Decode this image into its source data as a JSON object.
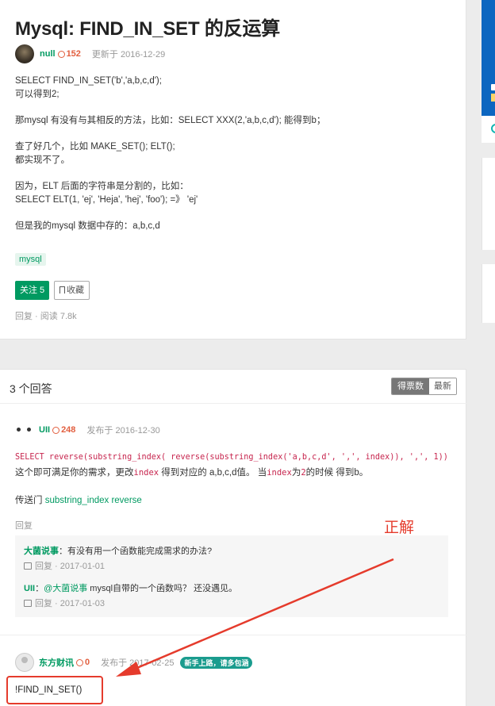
{
  "question": {
    "title": "Mysql: FIND_IN_SET 的反运算",
    "author": "null",
    "reputation": "152",
    "updated": "更新于 2016-12-29",
    "body": [
      "SELECT FIND_IN_SET('b','a,b,c,d');\n可以得到2;",
      "那mysql 有没有与其相反的方法，比如：SELECT XXX(2,'a,b,c,d'); 能得到b；",
      "查了好几个，比如 MAKE_SET(); ELT();\n都实现不了。",
      "因为，ELT 后面的字符串是分割的，比如：\nSELECT ELT(1, 'ej', 'Heja', 'hej', 'foo'); =》 'ej'",
      "但是我的mysql 数据中存的：a,b,c,d"
    ],
    "tag": "mysql",
    "follow_label": "关注 5",
    "favorite_label": "收藏",
    "actions": "回复 · 阅读 7.8k"
  },
  "answers_header": {
    "count_label": "3 个回答",
    "sort_votes": "得票数",
    "sort_latest": "最新"
  },
  "answer1": {
    "author": "UII",
    "reputation": "248",
    "date": "发布于 2016-12-30",
    "code": "SELECT reverse(substring_index( reverse(substring_index('a,b,c,d', ',', index)), ',', 1))",
    "text_a": "这个即可满足你的需求，更改",
    "kw1": "index",
    "text_b": " 得到对应的 a,b,c,d值。 当",
    "kw2": "index",
    "text_c": "为",
    "kw3": "2",
    "text_d": "的时候 得到b。",
    "link_prefix": "传送门 ",
    "link_text": "substring_index reverse",
    "reply_label": "回复"
  },
  "comments": [
    {
      "who": "大菌说事",
      "text": "：有没有用一个函数能完成需求的办法?",
      "meta": "回复 · 2017-01-01"
    },
    {
      "who": "UII",
      "text_prefix": "：",
      "at": "@大菌说事",
      "text": " mysql自带的一个函数吗？ 还没遇见。",
      "meta": "回复 · 2017-01-03"
    }
  ],
  "answer2": {
    "author": "东方财讯",
    "reputation": "0",
    "date": "发布于 2017-02-25",
    "badge": "新手上路，请多包涵",
    "text": "!FIND_IN_SET()"
  },
  "annotation": {
    "label": "正解",
    "color": "#e53b2c"
  },
  "colors": {
    "brand": "#009a61",
    "code": "#c7254e",
    "reputation": "#e25e3e"
  }
}
